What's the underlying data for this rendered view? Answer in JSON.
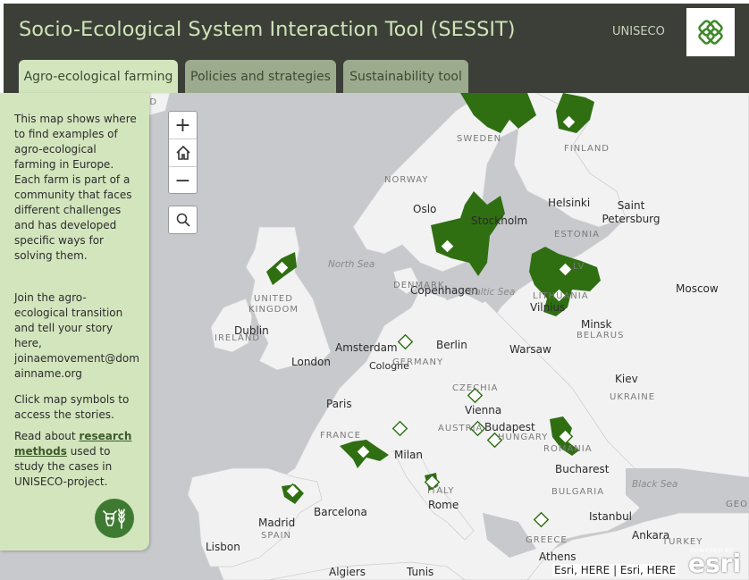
{
  "header": {
    "title": "Socio-Ecological System Interaction Tool (SESSIT)",
    "org": "UNISECO"
  },
  "tabs": [
    {
      "label": "Agro-ecological farming",
      "active": true
    },
    {
      "label": "Policies and strategies",
      "active": false
    },
    {
      "label": "Sustainability tool",
      "active": false
    }
  ],
  "panel": {
    "intro": "This map shows where to find examples of agro-ecological farming in Europe. Each farm is part of a community that faces different challenges and has developed specific ways for solving them.",
    "join": "Join the agro-ecological transition and tell your story here, joinaemovement@domainname.org",
    "click": "Click map symbols to access the stories.",
    "read_before": "Read about ",
    "read_link": "research methods",
    "read_after": " used to study the cases in UNISECO-project.",
    "icon": "cow-wheat-icon"
  },
  "map_controls": {
    "zoom_in": "+",
    "home_icon": "home-icon",
    "zoom_out": "−",
    "search_icon": "search-icon"
  },
  "map_labels": {
    "cities": [
      "Oslo",
      "Stockholm",
      "Helsinki",
      "Saint Petersburg",
      "Moscow",
      "Copenhagen",
      "Vilnius",
      "Minsk",
      "Dublin",
      "London",
      "Amsterdam",
      "Berlin",
      "Warsaw",
      "Cologne",
      "Kiev",
      "Paris",
      "Vienna",
      "Budapest",
      "Milan",
      "Bucharest",
      "Barcelona",
      "Rome",
      "Madrid",
      "Lisbon",
      "Istanbul",
      "Ankara",
      "Athens",
      "Algiers",
      "Tunis"
    ],
    "countries": [
      "SWEDEN",
      "FINLAND",
      "NORWAY",
      "ESTONIA",
      "LITHUANIA",
      "DENMARK",
      "UNITED KINGDOM",
      "IRELAND",
      "BELARUS",
      "GERMANY",
      "CZECHIA",
      "UKRAINE",
      "FRANCE",
      "AUSTRIA",
      "HUNGARY",
      "ROMANIA",
      "ITALY",
      "BULGARIA",
      "SPAIN",
      "GREECE",
      "TURKEY",
      "GEO",
      "ICELAND",
      "LV"
    ],
    "seas": [
      "North Sea",
      "Baltic Sea",
      "Black Sea"
    ]
  },
  "attribution": "Esri, HERE | Esri, HERE",
  "esri": {
    "powered": "POWERED BY",
    "brand": "esri"
  },
  "colors": {
    "header_bg": "#3b3f38",
    "title": "#cfe3b6",
    "panel_bg": "#d3e5bd",
    "tab_inactive": "#9cab8d",
    "region_green": "#2f6f12",
    "land": "#f2f2f2",
    "water": "#c8c9cd"
  }
}
